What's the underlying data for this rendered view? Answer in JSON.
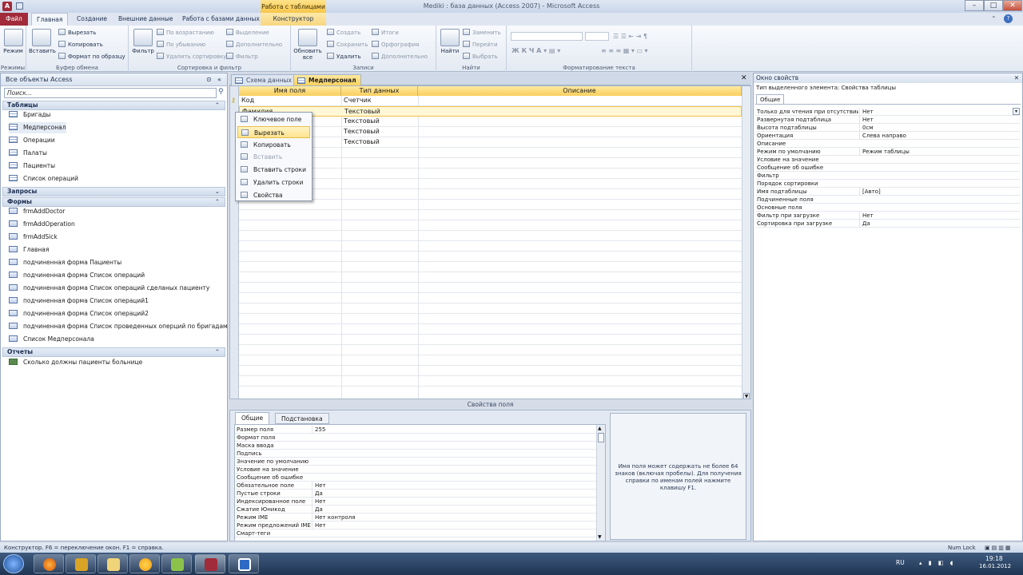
{
  "window": {
    "title": "Mediki : база данных (Access 2007) - Microsoft Access",
    "context_group": "Работа с таблицами",
    "controls": [
      "–",
      "□",
      "✕"
    ]
  },
  "ribbon_tabs": [
    "Файл",
    "Главная",
    "Создание",
    "Внешние данные",
    "Работа с базами данных",
    "Конструктор"
  ],
  "ribbon": {
    "groups": {
      "views": "Режимы",
      "clipboard": "Буфер обмена",
      "sortfilter": "Сортировка и фильтр",
      "records": "Записи",
      "find": "Найти",
      "textformat": "Форматирование текста"
    },
    "views_btn": "Режим",
    "paste_btn": "Вставить",
    "cut": "Вырезать",
    "copy": "Копировать",
    "format_painter": "Формат по образцу",
    "filter_btn": "Фильтр",
    "sort_asc": "По возрастанию",
    "sort_desc": "По убыванию",
    "remove_sort": "Удалить сортировку",
    "selection": "Выделение",
    "advanced": "Дополнительно",
    "toggle_filter": "Фильтр",
    "refresh_btn": "Обновить все",
    "new_rec": "Создать",
    "save_rec": "Сохранить",
    "delete_rec": "Удалить",
    "totals": "Итоги",
    "spelling": "Орфография",
    "more": "Дополнительно",
    "find_btn": "Найти",
    "replace": "Заменить",
    "goto": "Перейти",
    "select": "Выбрать"
  },
  "nav": {
    "header": "Все объекты Access",
    "search_placeholder": "Поиск...",
    "sections": [
      {
        "title": "Таблицы",
        "chevron": "⌃",
        "items": [
          "Бригады",
          "Медперсонал",
          "Операции",
          "Палаты",
          "Пациенты",
          "Список операций"
        ]
      },
      {
        "title": "Запросы",
        "chevron": "⌄",
        "items": []
      },
      {
        "title": "Формы",
        "chevron": "⌃",
        "items": [
          "frmAddDoctor",
          "frmAddOperation",
          "frmAddSick",
          "Главная",
          "подчиненная форма Пациенты",
          "подчиненная форма Список операций",
          "подчиненная форма Список операций сделаных пациенту",
          "подчиненная форма Список операций1",
          "подчиненная форма Список операций2",
          "подчиненная форма Список проведенных оперций по бригадам",
          "Список Медперсонала"
        ]
      },
      {
        "title": "Отчеты",
        "chevron": "⌃",
        "items": [
          "Сколько должны пациенты больнице"
        ]
      }
    ]
  },
  "doc_tabs": [
    "Схема данных",
    "Медперсонал"
  ],
  "design_grid": {
    "headers": [
      "Имя поля",
      "Тип данных",
      "Описание"
    ],
    "rows": [
      {
        "name": "Код",
        "type": "Счетчик",
        "desc": ""
      },
      {
        "name": "Фамилия",
        "type": "Текстовый",
        "desc": ""
      },
      {
        "name": "",
        "type": "Текстовый",
        "desc": ""
      },
      {
        "name": "",
        "type": "Текстовый",
        "desc": ""
      },
      {
        "name": "",
        "type": "Текстовый",
        "desc": ""
      }
    ]
  },
  "context_menu": {
    "items": [
      {
        "label": "Ключевое поле",
        "state": "normal"
      },
      {
        "label": "Вырезать",
        "state": "hover"
      },
      {
        "label": "Копировать",
        "state": "normal"
      },
      {
        "label": "Вставить",
        "state": "disabled"
      },
      {
        "label": "Вставить строки",
        "state": "normal"
      },
      {
        "label": "Удалить строки",
        "state": "normal"
      },
      {
        "label": "Свойства",
        "state": "normal"
      }
    ]
  },
  "field_props": {
    "title": "Свойства поля",
    "tabs": [
      "Общие",
      "Подстановка"
    ],
    "rows": [
      [
        "Размер поля",
        "255"
      ],
      [
        "Формат поля",
        ""
      ],
      [
        "Маска ввода",
        ""
      ],
      [
        "Подпись",
        ""
      ],
      [
        "Значение по умолчанию",
        ""
      ],
      [
        "Условие на значение",
        ""
      ],
      [
        "Сообщение об ошибке",
        ""
      ],
      [
        "Обязательное поле",
        "Нет"
      ],
      [
        "Пустые строки",
        "Да"
      ],
      [
        "Индексированное поле",
        "Нет"
      ],
      [
        "Сжатие Юникод",
        "Да"
      ],
      [
        "Режим IME",
        "Нет контроля"
      ],
      [
        "Режим предложений IME",
        "Нет"
      ],
      [
        "Смарт-теги",
        ""
      ]
    ],
    "help": "Имя поля может содержать не более 64 знаков (включая пробелы). Для получения справки по именам полей нажмите клавишу F1."
  },
  "property_sheet": {
    "title": "Окно свойств",
    "close": "✕",
    "selection_type": "Тип выделенного элемента:  Свойства таблицы",
    "tab": "Общие",
    "rows": [
      [
        "Только для чтения при отсутствии",
        "Нет"
      ],
      [
        "Развернутая подтаблица",
        "Нет"
      ],
      [
        "Высота подтаблицы",
        "0см"
      ],
      [
        "Ориентация",
        "Слева направо"
      ],
      [
        "Описание",
        ""
      ],
      [
        "Режим по умолчанию",
        "Режим таблицы"
      ],
      [
        "Условие на значение",
        ""
      ],
      [
        "Сообщение об ошибке",
        ""
      ],
      [
        "Фильтр",
        ""
      ],
      [
        "Порядок сортировки",
        ""
      ],
      [
        "Имя подтаблицы",
        "[Авто]"
      ],
      [
        "Подчиненные поля",
        ""
      ],
      [
        "Основные поля",
        ""
      ],
      [
        "Фильтр при загрузке",
        "Нет"
      ],
      [
        "Сортировка при загрузке",
        "Да"
      ]
    ]
  },
  "status": {
    "left": "Конструктор.  F6 = переключение окон.  F1 = справка.",
    "numlock": "Num Lock"
  },
  "taskbar": {
    "lang": "RU",
    "time": "19:18",
    "date": "16.01.2012",
    "apps": [
      "start",
      "firefox",
      "media",
      "explorer",
      "uploader",
      "android",
      "access",
      "window"
    ]
  },
  "colors": {
    "file_tab": "#a12b3a",
    "context_yellow": "#fad15e",
    "taskbar": "#1f3553"
  }
}
